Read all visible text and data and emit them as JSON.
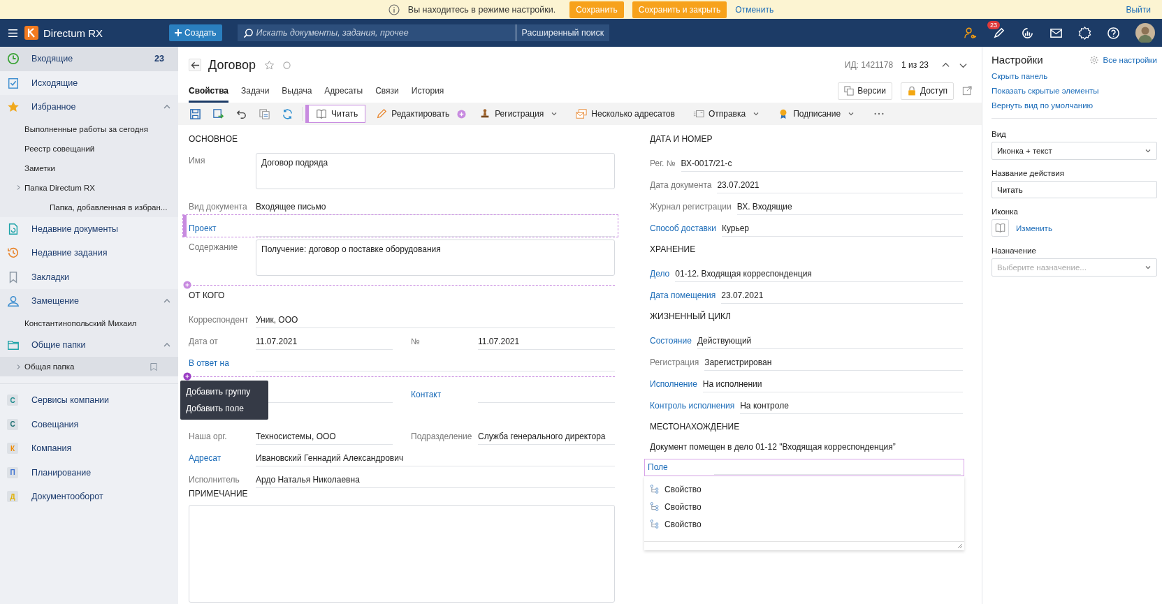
{
  "notice": {
    "text": "Вы находитесь в режиме настройки.",
    "save": "Сохранить",
    "save_close": "Сохранить и закрыть",
    "cancel": "Отменить",
    "logout": "Выйти"
  },
  "header": {
    "app_name": "Directum RX",
    "create": "Создать",
    "search": {
      "placeholder": "Искать документы, задания, прочее"
    },
    "advanced_search": "Расширенный поиск",
    "badge": "23"
  },
  "sidebar": {
    "items": [
      {
        "label": "Входящие",
        "count": "23",
        "selected": true
      },
      {
        "label": "Исходящие",
        "selected": false
      },
      {
        "label": "Избранное",
        "selected": false,
        "expanded": true,
        "children": [
          {
            "label": "Выполненные работы за сегодня",
            "selected": false
          },
          {
            "label": "Реестр совещаний",
            "selected": false
          },
          {
            "label": "Заметки",
            "selected": false
          },
          {
            "label": "Папка Directum RX",
            "selected": false,
            "expanded": false,
            "children": [
              {
                "label": "Папка, добавленная в избран...",
                "selected": false
              }
            ]
          }
        ]
      },
      {
        "label": "Недавние документы",
        "selected": false
      },
      {
        "label": "Недавние задания",
        "selected": false
      },
      {
        "label": "Закладки",
        "selected": false
      },
      {
        "label": "Замещение",
        "selected": false,
        "expanded": true,
        "children": [
          {
            "label": "Константинопольский Михаил",
            "selected": false
          }
        ]
      },
      {
        "label": "Общие папки",
        "selected": false,
        "expanded": true,
        "children": [
          {
            "label": "Общая папка",
            "selected": true,
            "expanded": false,
            "bookmarked": false
          }
        ]
      }
    ],
    "modules": [
      {
        "letter": "С",
        "label": "Сервисы компании",
        "color": "#1b8a8c"
      },
      {
        "letter": "С",
        "label": "Совещания",
        "color": "#1b6e70"
      },
      {
        "letter": "К",
        "label": "Компания",
        "color": "#f08a00"
      },
      {
        "letter": "П",
        "label": "Планирование",
        "color": "#3a6fd0"
      },
      {
        "letter": "Д",
        "label": "Документооборот",
        "color": "#e0b000"
      }
    ]
  },
  "document": {
    "title": "Договор",
    "favorite": false,
    "id": "ИД: 1421178",
    "position": "1 из 23"
  },
  "tabs": [
    {
      "label": "Свойства",
      "selected": true
    },
    {
      "label": "Задачи",
      "selected": false
    },
    {
      "label": "Выдача",
      "selected": false
    },
    {
      "label": "Адресаты",
      "selected": false
    },
    {
      "label": "Связи",
      "selected": false
    },
    {
      "label": "История",
      "selected": false
    }
  ],
  "doc_buttons": [
    "Версии",
    "Доступ"
  ],
  "toolbar": {
    "commands": [
      {
        "label": "Читать",
        "kind": "button",
        "highlighted": true,
        "insert_marker": false
      },
      {
        "label": "Редактировать",
        "kind": "button",
        "highlighted": false,
        "insert_marker": true
      },
      {
        "label": "Регистрация",
        "kind": "menu",
        "highlighted": false,
        "insert_marker": false
      },
      {
        "label": "Несколько адресатов",
        "kind": "button",
        "highlighted": false,
        "insert_marker": false
      },
      {
        "label": "Отправка",
        "kind": "menu",
        "highlighted": false,
        "insert_marker": false
      },
      {
        "label": "Подписание",
        "kind": "menu",
        "highlighted": false,
        "insert_marker": false
      }
    ]
  },
  "form": {
    "left": [
      {
        "kind": "section",
        "title": "ОСНОВНОЕ",
        "fields": [
          {
            "kind": "memo",
            "label": "Имя",
            "value": "Договор подряда",
            "link": false,
            "highlighted": false
          },
          {
            "kind": "line",
            "label": "Вид документа",
            "value": "Входящее письмо",
            "link": false,
            "highlighted": false
          },
          {
            "kind": "line",
            "label": "Проект",
            "link": true,
            "highlighted": true
          },
          {
            "kind": "memo",
            "label": "Содержание",
            "value": "Получение: договор о поставке оборудования",
            "link": false,
            "highlighted": false
          }
        ]
      },
      {
        "kind": "insert",
        "active": false
      },
      {
        "kind": "section",
        "title": "ОТ КОГО",
        "fields": [
          {
            "kind": "line",
            "label": "Корреспондент",
            "value": "Уник, ООО",
            "link": false,
            "highlighted": false
          },
          {
            "kind": "pair",
            "fields": [
              {
                "label": "Дата от",
                "value": "11.07.2021",
                "link": false
              },
              {
                "label": "№",
                "value": "11.07.2021",
                "link": false
              }
            ]
          },
          {
            "kind": "line",
            "label": "В ответ на",
            "link": true,
            "highlighted": false
          }
        ]
      },
      {
        "kind": "insert",
        "active": true,
        "menu": [
          "Добавить группу",
          "Добавить поле"
        ]
      },
      {
        "kind": "section",
        "fields": [
          {
            "kind": "half_line",
            "label": "Контакт",
            "link": true,
            "highlighted": false
          }
        ]
      },
      {
        "kind": "section",
        "fields": [
          {
            "kind": "pair",
            "fields": [
              {
                "label": "Наша орг.",
                "value": "Техносистемы, ООО",
                "link": false
              },
              {
                "label": "Подразделение",
                "value": "Служба генерального директора",
                "link": false
              }
            ]
          },
          {
            "kind": "line",
            "label": "Адресат",
            "value": "Ивановский Геннадий Александрович",
            "link": true,
            "highlighted": false
          },
          {
            "kind": "line",
            "label": "Исполнитель",
            "value": "Ардо Наталья Николаевна",
            "link": false,
            "highlighted": false
          }
        ]
      },
      {
        "kind": "section",
        "title": "ПРИМЕЧАНИЕ",
        "fields": [
          {
            "kind": "note"
          }
        ]
      }
    ],
    "right": [
      {
        "kind": "section",
        "title": "ДАТА И НОМЕР",
        "fields": [
          {
            "kind": "line",
            "label": "Рег. №",
            "value": "ВХ-0017/21-с",
            "link": false,
            "highlighted": false
          },
          {
            "kind": "line",
            "label": "Дата документа",
            "value": "23.07.2021",
            "link": false,
            "highlighted": false
          },
          {
            "kind": "line",
            "label": "Журнал регистрации",
            "value": "ВХ. Входящие",
            "link": false,
            "highlighted": false
          },
          {
            "kind": "line",
            "label": "Способ доставки",
            "value": "Курьер",
            "link": true,
            "highlighted": false
          }
        ]
      },
      {
        "kind": "section",
        "title": "ХРАНЕНИЕ",
        "fields": [
          {
            "kind": "line",
            "label": "Дело",
            "value": "01-12. Входящая корреспонденция",
            "link": true,
            "highlighted": false
          },
          {
            "kind": "line",
            "label": "Дата помещения",
            "value": "23.07.2021",
            "link": true,
            "highlighted": false
          }
        ]
      },
      {
        "kind": "section",
        "title": "ЖИЗНЕННЫЙ ЦИКЛ",
        "fields": [
          {
            "kind": "line",
            "label": "Состояние",
            "value": "Действующий",
            "link": true,
            "highlighted": false
          },
          {
            "kind": "line",
            "label": "Регистрация",
            "value": "Зарегистрирован",
            "link": false,
            "highlighted": false
          },
          {
            "kind": "line",
            "label": "Исполнение",
            "value": "На исполнении",
            "link": true,
            "highlighted": false
          },
          {
            "kind": "line",
            "label": "Контроль исполнения",
            "value": "На контроле",
            "link": true,
            "highlighted": false
          }
        ]
      },
      {
        "kind": "section",
        "title": "МЕСТОНАХОЖДЕНИЕ",
        "fields": [
          {
            "kind": "text",
            "value": "Документ помещен в дело 01-12 \"Входящая корреспонденция”"
          },
          {
            "kind": "picker",
            "label": "Поле",
            "expanded": true,
            "options": [
              "Свойство",
              "Свойство",
              "Свойство"
            ]
          }
        ]
      }
    ]
  },
  "settings": {
    "title": "Настройки",
    "all_settings": "Все настройки",
    "links": [
      "Скрыть панель",
      "Показать скрытые элементы",
      "Вернуть вид по умолчанию"
    ],
    "view": {
      "label": "Вид",
      "value": "Иконка + текст"
    },
    "action_name": {
      "label": "Название действия",
      "value": "Читать"
    },
    "icon": {
      "label": "Иконка",
      "change": "Изменить"
    },
    "purpose": {
      "label": "Назначение",
      "placeholder": "Выберите назначение..."
    }
  }
}
